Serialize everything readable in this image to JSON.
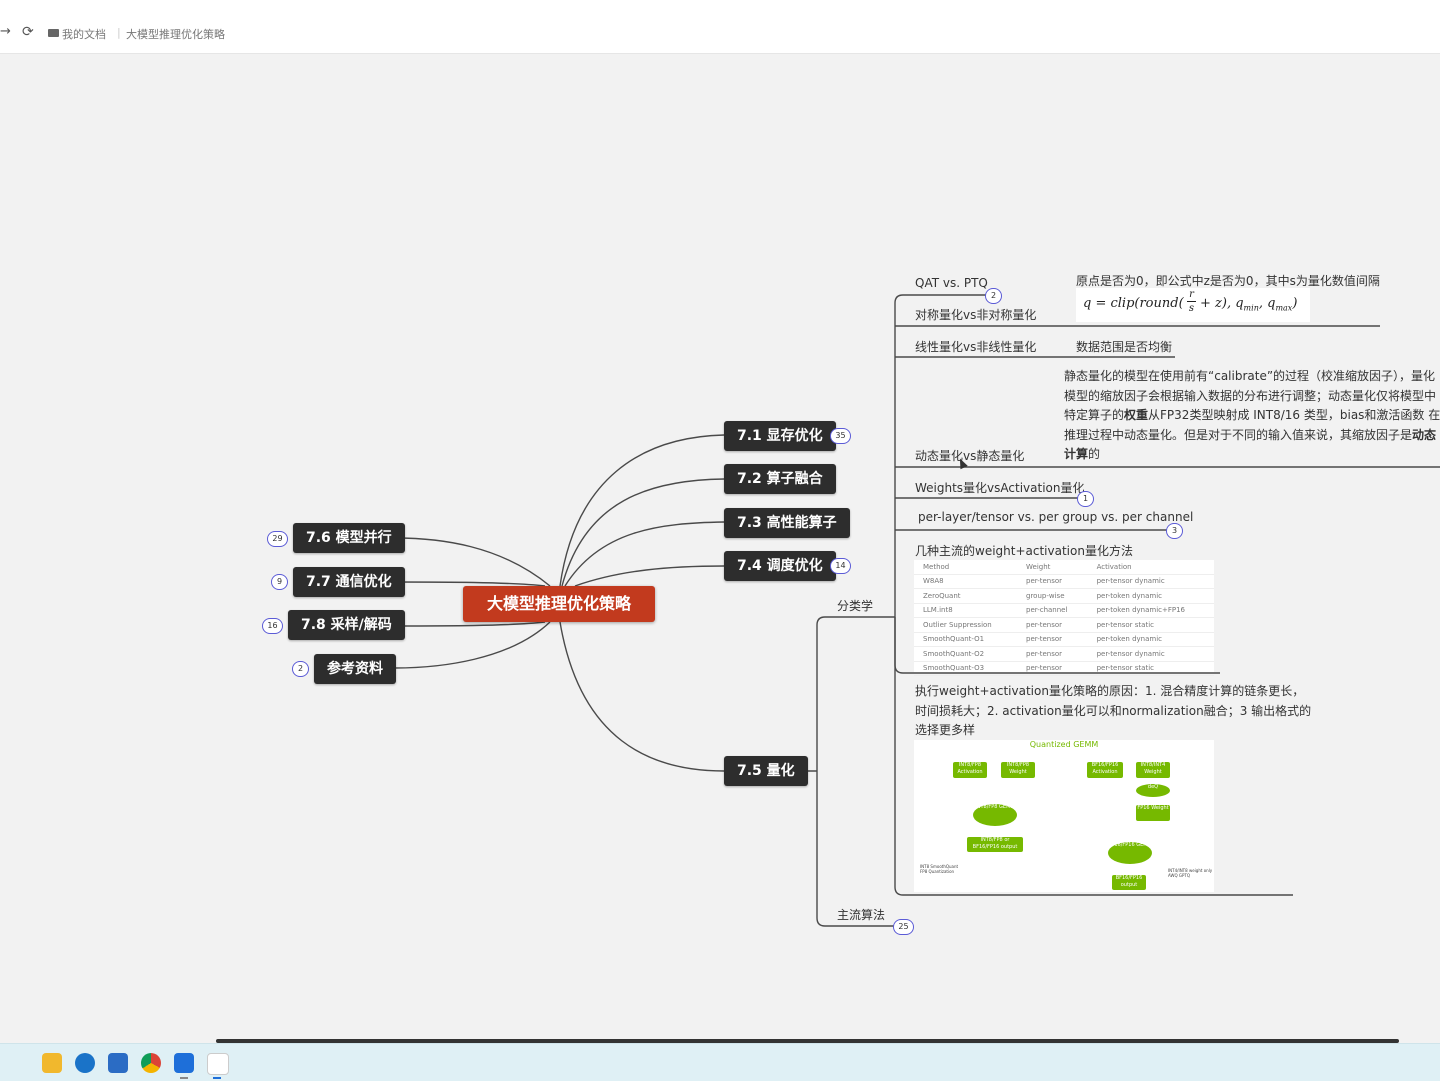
{
  "topbar": {
    "back_arrow": "→",
    "refresh": "⟳",
    "folder_label": "我的文档",
    "separator": "|",
    "doc_title": "大模型推理优化策略"
  },
  "mindmap": {
    "root": "大模型推理优化策略",
    "branches": [
      {
        "label": "7.1 显存优化",
        "count": "35"
      },
      {
        "label": "7.2 算子融合"
      },
      {
        "label": "7.3 高性能算子"
      },
      {
        "label": "7.4 调度优化",
        "count": "14"
      },
      {
        "label": "7.5 量化"
      },
      {
        "label": "7.6 模型并行",
        "count": "29"
      },
      {
        "label": "7.7 通信优化",
        "count": "9"
      },
      {
        "label": "7.8 采样/解码",
        "count": "16"
      },
      {
        "label": "参考资料",
        "count": "2"
      }
    ],
    "quant": {
      "taxonomy": "分类学",
      "mainstream": "主流算法",
      "mainstream_count": "25",
      "qat_ptq": "QAT vs. PTQ",
      "sym": "对称量化vs非对称量化",
      "sym_count": "2",
      "sym_note": "原点是否为0，即公式中z是否为0，其中s为量化数值间隔",
      "linear": "线性量化vs非线性量化",
      "linear_note": "数据范围是否均衡",
      "dyn": "动态量化vs静态量化",
      "dyn_note": [
        "静态量化的模型在使用前有“calibrate”的过程（校准缩放因子），量化",
        "模型的缩放因子会根据输入数据的分布进行调整；动态量化仅将模型中",
        "特定算子的",
        "权重",
        "从FP32类型映射成 INT8/16 类型，bias和激活函数 在",
        "推理过程中动态量化。但是对于不同的输入值来说，其缩放因子是",
        "动态",
        "计算",
        "的"
      ],
      "wa": "Weights量化vsActivation量化",
      "wa_count": "1",
      "gran": "per-layer/tensor vs. per group vs. per channel",
      "gran_count": "3",
      "methods": "几种主流的weight+activation量化方法",
      "table": {
        "headers": [
          "Method",
          "Weight",
          "Activation"
        ],
        "rows": [
          [
            "W8A8",
            "per-tensor",
            "per-tensor dynamic"
          ],
          [
            "ZeroQuant",
            "group-wise",
            "per-token dynamic"
          ],
          [
            "LLM.int8",
            "per-channel",
            "per-token dynamic+FP16"
          ],
          [
            "Outlier Suppression",
            "per-tensor",
            "per-tensor static"
          ],
          [
            "SmoothQuant-O1",
            "per-tensor",
            "per-token dynamic"
          ],
          [
            "SmoothQuant-O2",
            "per-tensor",
            "per-tensor dynamic"
          ],
          [
            "SmoothQuant-O3",
            "per-tensor",
            "per-tensor static"
          ]
        ]
      },
      "reason": [
        "执行weight+activation量化策略的原因：1. 混合精度计算的链条更长，",
        "时间损耗大；2. activation量化可以和normalization融合；3 输出格式的",
        "选择更多样"
      ],
      "gemm": {
        "title": "Quantized GEMM",
        "boxes": [
          "INT8/FP8 Activation",
          "INT8/FP8 Weight",
          "BF16/FP16 Activation",
          "INT8/INT4 Weight",
          "FP16 Weight",
          "BF16/FP16 output"
        ],
        "ellipses": [
          "INT8/FP8 GEMM",
          "deQ",
          "BF16/FP16 GEMM"
        ],
        "output_left": "INT8/FP8 or BF16/FP16 output",
        "caption_left": "INT8 SmoothQuant FP8 Quantization",
        "caption_right": "INT4/INT8 weight only AWQ GPTQ"
      }
    }
  },
  "colors": {
    "root": "#c23a1e",
    "node": "#2d2d2d",
    "badge": "#5b5bd6",
    "nvidia": "#76b900"
  },
  "taskbar": {
    "icons": [
      "file-explorer-icon",
      "edge-icon",
      "store-icon",
      "chrome-icon",
      "app-icon",
      "grid-app-icon"
    ]
  }
}
